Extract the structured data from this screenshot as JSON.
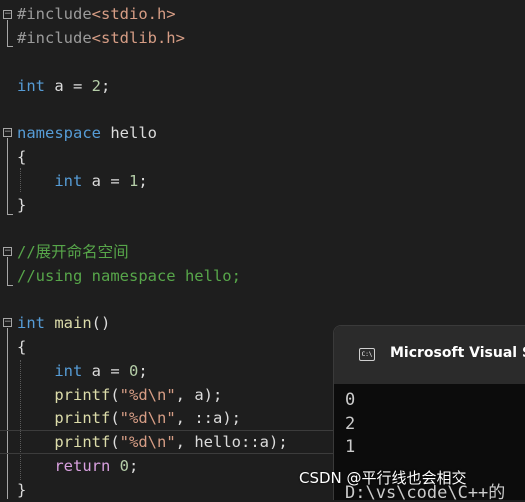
{
  "editor": {
    "lines": [
      {
        "parts": [
          {
            "t": "#include",
            "c": "pp"
          },
          {
            "t": "<stdio.h>",
            "c": "inc"
          }
        ]
      },
      {
        "parts": [
          {
            "t": "#include",
            "c": "pp"
          },
          {
            "t": "<stdlib.h>",
            "c": "inc"
          }
        ]
      },
      {
        "parts": []
      },
      {
        "parts": [
          {
            "t": "int",
            "c": "kw"
          },
          {
            "t": " a = ",
            "c": "txt"
          },
          {
            "t": "2",
            "c": "num"
          },
          {
            "t": ";",
            "c": "txt"
          }
        ]
      },
      {
        "parts": []
      },
      {
        "parts": [
          {
            "t": "namespace",
            "c": "kw"
          },
          {
            "t": " hello",
            "c": "txt"
          }
        ]
      },
      {
        "parts": [
          {
            "t": "{",
            "c": "txt"
          }
        ]
      },
      {
        "parts": [
          {
            "t": "    ",
            "c": "txt"
          },
          {
            "t": "int",
            "c": "kw"
          },
          {
            "t": " a = ",
            "c": "txt"
          },
          {
            "t": "1",
            "c": "num"
          },
          {
            "t": ";",
            "c": "txt"
          }
        ]
      },
      {
        "parts": [
          {
            "t": "}",
            "c": "txt"
          }
        ]
      },
      {
        "parts": []
      },
      {
        "parts": [
          {
            "t": "//展开命名空间",
            "c": "cmt"
          }
        ]
      },
      {
        "parts": [
          {
            "t": "//using namespace hello;",
            "c": "cmt"
          }
        ]
      },
      {
        "parts": []
      },
      {
        "parts": [
          {
            "t": "int",
            "c": "kw"
          },
          {
            "t": " ",
            "c": "txt"
          },
          {
            "t": "main",
            "c": "fn"
          },
          {
            "t": "()",
            "c": "txt"
          }
        ]
      },
      {
        "parts": [
          {
            "t": "{",
            "c": "txt"
          }
        ]
      },
      {
        "parts": [
          {
            "t": "    ",
            "c": "txt"
          },
          {
            "t": "int",
            "c": "kw"
          },
          {
            "t": " a = ",
            "c": "txt"
          },
          {
            "t": "0",
            "c": "num"
          },
          {
            "t": ";",
            "c": "txt"
          }
        ]
      },
      {
        "parts": [
          {
            "t": "    ",
            "c": "txt"
          },
          {
            "t": "printf",
            "c": "fn"
          },
          {
            "t": "(",
            "c": "txt"
          },
          {
            "t": "\"%d\\n\"",
            "c": "str"
          },
          {
            "t": ", a);",
            "c": "txt"
          }
        ]
      },
      {
        "parts": [
          {
            "t": "    ",
            "c": "txt"
          },
          {
            "t": "printf",
            "c": "fn"
          },
          {
            "t": "(",
            "c": "txt"
          },
          {
            "t": "\"%d\\n\"",
            "c": "str"
          },
          {
            "t": ", ::a);",
            "c": "txt"
          }
        ]
      },
      {
        "parts": [
          {
            "t": "    ",
            "c": "txt"
          },
          {
            "t": "printf",
            "c": "fn"
          },
          {
            "t": "(",
            "c": "txt"
          },
          {
            "t": "\"%d\\n\"",
            "c": "str"
          },
          {
            "t": ", hello::a);",
            "c": "txt"
          }
        ]
      },
      {
        "parts": [
          {
            "t": "    ",
            "c": "txt"
          },
          {
            "t": "return",
            "c": "ret"
          },
          {
            "t": " ",
            "c": "txt"
          },
          {
            "t": "0",
            "c": "num"
          },
          {
            "t": ";",
            "c": "txt"
          }
        ]
      },
      {
        "parts": [
          {
            "t": "}",
            "c": "txt"
          }
        ]
      }
    ],
    "fold_markers": [
      "−",
      "−",
      "−",
      "−"
    ]
  },
  "console": {
    "icon_text": "C:\\",
    "title": "Microsoft Visual Stu",
    "output": [
      "0",
      "2",
      "1",
      "D:\\vs\\code\\C++的"
    ]
  },
  "watermark": "CSDN @平行线也会相交",
  "colors": {
    "background": "#1e1e1e",
    "keyword": "#569cd6",
    "comment": "#57a64a",
    "function": "#dcdcaa",
    "string": "#d69d85",
    "number": "#b5cea8",
    "console_bg": "#0c0c0c"
  }
}
